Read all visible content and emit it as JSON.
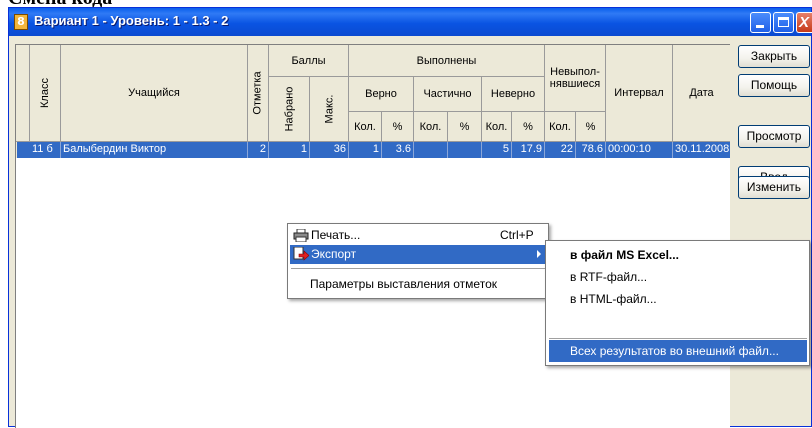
{
  "heading_fragment": "Смена кода",
  "window": {
    "title": "Вариант 1 - Уровень: 1 - 1.3 - 2",
    "icon_glyph": "8",
    "close_glyph": "X"
  },
  "grid": {
    "headers": {
      "klass": "Класс",
      "student": "Учащийся",
      "mark": "Отметка",
      "scores": "Баллы",
      "scored": "Набрано",
      "max": "Макс.",
      "done": "Выполнены",
      "correct": "Верно",
      "partial": "Частично",
      "wrong": "Неверно",
      "undone": "Невыпол-нявшиеся",
      "interval": "Интервал",
      "date": "Дата",
      "count": "Кол.",
      "percent": "%"
    },
    "rows": [
      {
        "klass": "11 б",
        "student": "Балыбердин Виктор",
        "mark": "2",
        "scored": "1",
        "max": "36",
        "correct_count": "1",
        "correct_pct": "3.6",
        "partial_count": "",
        "partial_pct": "",
        "wrong_count": "5",
        "wrong_pct": "17.9",
        "undone_count": "22",
        "undone_pct": "78.6",
        "interval": "00:00:10",
        "date": "30.11.2008"
      }
    ]
  },
  "buttons": {
    "close": "Закрыть",
    "help": "Помощь",
    "view": "Просмотр",
    "input": "Ввод",
    "edit": "Изменить"
  },
  "context_menu": {
    "print": "Печать...",
    "print_shortcut": "Ctrl+P",
    "export": "Экспорт",
    "params": "Параметры выставления отметок"
  },
  "submenu": {
    "excel": "в файл MS Excel...",
    "rtf": "в RTF-файл...",
    "html": "в HTML-файл...",
    "all": "Всех результатов во внешний файл..."
  },
  "colors": {
    "title_bar": "#0a54e3",
    "selection": "#316ac5",
    "face": "#ece9d8"
  },
  "icons": [
    "app-icon",
    "minimize-icon",
    "maximize-icon",
    "close-icon",
    "row-indicator-icon",
    "printer-icon",
    "export-icon",
    "submenu-arrow-icon"
  ]
}
